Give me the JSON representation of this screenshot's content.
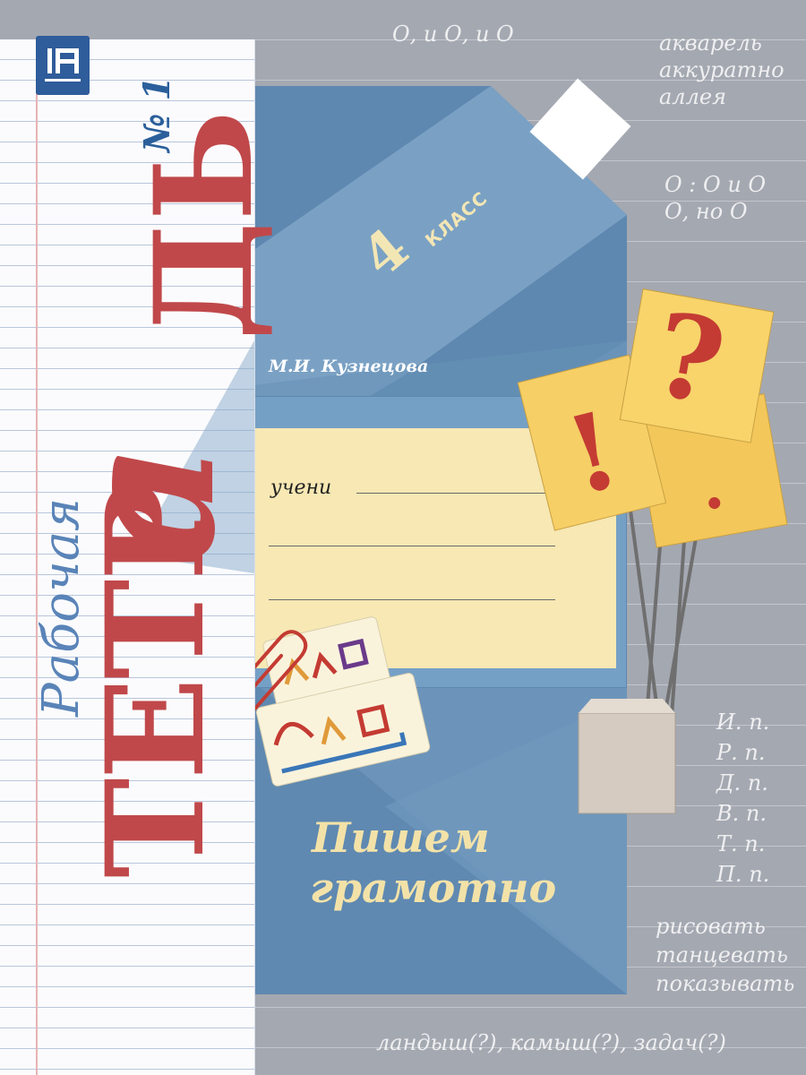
{
  "publisher_logo": {
    "letters": "П",
    "color": "#2f5c9a"
  },
  "title": {
    "line1": "Рабочая",
    "part_tetr": "ТЕТР",
    "part_a": "а",
    "part_d": "ДЬ",
    "number": "№ 1"
  },
  "grade": {
    "number": "4",
    "word": "КЛАСС"
  },
  "author": "М.И. Кузнецова",
  "form": {
    "label": "учени"
  },
  "subtitle": {
    "line1": "Пишем",
    "line2": "грамотно"
  },
  "signs": {
    "exclamation": "!",
    "question": "?"
  },
  "background_writing": {
    "top": "О, и О, и О",
    "words1": [
      "акварель",
      "аккуратно",
      "аллея"
    ],
    "o_lines": [
      "О : О и О",
      "О, но О"
    ],
    "cases": [
      "И. п.",
      "Р. п.",
      "Д. п.",
      "В. п.",
      "Т. п.",
      "П. п."
    ],
    "verbs": [
      "рисовать",
      "танцевать",
      "показывать"
    ],
    "bottom": "ландыш(?),   камыш(?),   задач(?)"
  },
  "colors": {
    "title_red": "#c0484a",
    "title_blue": "#5a84b8",
    "envelope": "#6a92b8",
    "card_yellow": "#f7e8b4",
    "sign_yellow": "#f6cf66"
  }
}
